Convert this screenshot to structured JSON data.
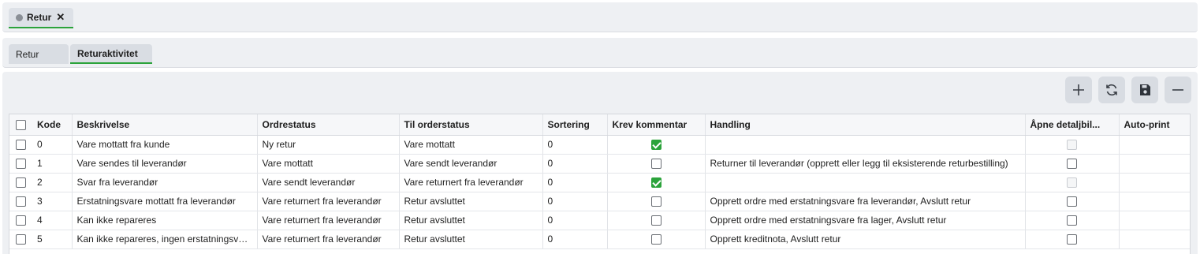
{
  "doc_tab": {
    "label": "Retur",
    "close": "✕"
  },
  "sub_tabs": [
    {
      "label": "Retur"
    },
    {
      "label": "Returaktivitet"
    }
  ],
  "toolbar": {
    "buttons": [
      {
        "icon": "plus-icon"
      },
      {
        "icon": "refresh-icon"
      },
      {
        "icon": "save-icon"
      },
      {
        "icon": "minus-icon"
      }
    ]
  },
  "table": {
    "headers": {
      "kode": "Kode",
      "beskrivelse": "Beskrivelse",
      "ordrestatus": "Ordrestatus",
      "til_orderstatus": "Til orderstatus",
      "sortering": "Sortering",
      "krev_kommentar": "Krev kommentar",
      "handling": "Handling",
      "apne_detalj": "Åpne detaljbil...",
      "auto_print": "Auto-print"
    },
    "rows": [
      {
        "kode": "0",
        "beskrivelse": "Vare mottatt fra kunde",
        "ordrestatus": "Ny retur",
        "til_orderstatus": "Vare mottatt",
        "sortering": "0",
        "krev_kommentar": true,
        "handling": "",
        "apne_detalj": "disabled"
      },
      {
        "kode": "1",
        "beskrivelse": "Vare sendes til leverandør",
        "ordrestatus": "Vare mottatt",
        "til_orderstatus": "Vare sendt leverandør",
        "sortering": "0",
        "krev_kommentar": false,
        "handling": "Returner til leverandør (opprett eller legg til eksisterende returbestilling)",
        "apne_detalj": "unchecked"
      },
      {
        "kode": "2",
        "beskrivelse": "Svar fra leverandør",
        "ordrestatus": "Vare sendt leverandør",
        "til_orderstatus": "Vare returnert fra leverandør",
        "sortering": "0",
        "krev_kommentar": true,
        "handling": "",
        "apne_detalj": "disabled"
      },
      {
        "kode": "3",
        "beskrivelse": "Erstatningsvare mottatt fra leverandør",
        "ordrestatus": "Vare returnert fra leverandør",
        "til_orderstatus": "Retur avsluttet",
        "sortering": "0",
        "krev_kommentar": false,
        "handling": "Opprett ordre med erstatningsvare fra leverandør, Avslutt retur",
        "apne_detalj": "unchecked"
      },
      {
        "kode": "4",
        "beskrivelse": "Kan ikke repareres",
        "ordrestatus": "Vare returnert fra leverandør",
        "til_orderstatus": "Retur avsluttet",
        "sortering": "0",
        "krev_kommentar": false,
        "handling": "Opprett ordre med erstatningsvare fra lager, Avslutt retur",
        "apne_detalj": "unchecked"
      },
      {
        "kode": "5",
        "beskrivelse": "Kan ikke repareres, ingen erstatningsvare",
        "ordrestatus": "Vare returnert fra leverandør",
        "til_orderstatus": "Retur avsluttet",
        "sortering": "0",
        "krev_kommentar": false,
        "handling": "Opprett kreditnota, Avslutt retur",
        "apne_detalj": "unchecked"
      }
    ]
  },
  "colors": {
    "accent": "#2ba33b",
    "panel": "#eef0f3",
    "button": "#d8dce2"
  }
}
